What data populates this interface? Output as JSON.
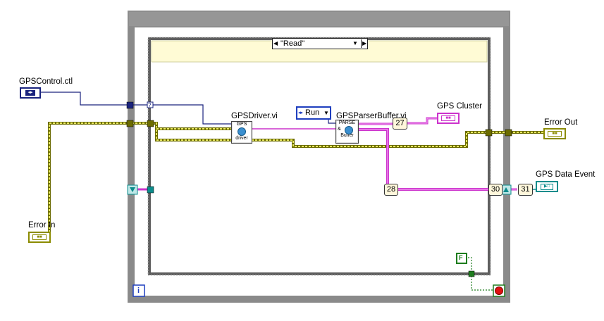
{
  "terminals": {
    "gps_control": "GPSControl.ctl",
    "error_in": "Error In",
    "error_out": "Error Out",
    "gps_cluster": "GPS Cluster",
    "gps_data_event": "GPS Data Event"
  },
  "case_structure": {
    "selector_value": "\"Read\"",
    "selector_terminal": "?"
  },
  "subvis": {
    "driver_title": "GPSDriver.vi",
    "driver_icon_top": "GPS",
    "driver_icon_bottom": "driver",
    "parser_title": "GPSParserBuffer.vi",
    "parser_icon_top": "PARSE",
    "parser_icon_mid": "&",
    "parser_icon_bottom": "Buffer"
  },
  "constants": {
    "run_enum": "Run",
    "stop_constant": "F"
  },
  "bundle_indices": {
    "idx_27": "27",
    "idx_28": "28",
    "idx_30": "30",
    "idx_31": "31"
  },
  "loop": {
    "iteration_terminal": "i"
  },
  "colors": {
    "error_wire": "#8b8b00",
    "cluster_wire": "#cc33cc",
    "refnum_wire": "#1a237e",
    "enum_blue": "#1f3fbf",
    "boolean_green": "#1e7d1e",
    "loop_frame": "#8a8a8a",
    "case_frame": "#6e6e6e",
    "event_teal": "#0c8c8c"
  }
}
